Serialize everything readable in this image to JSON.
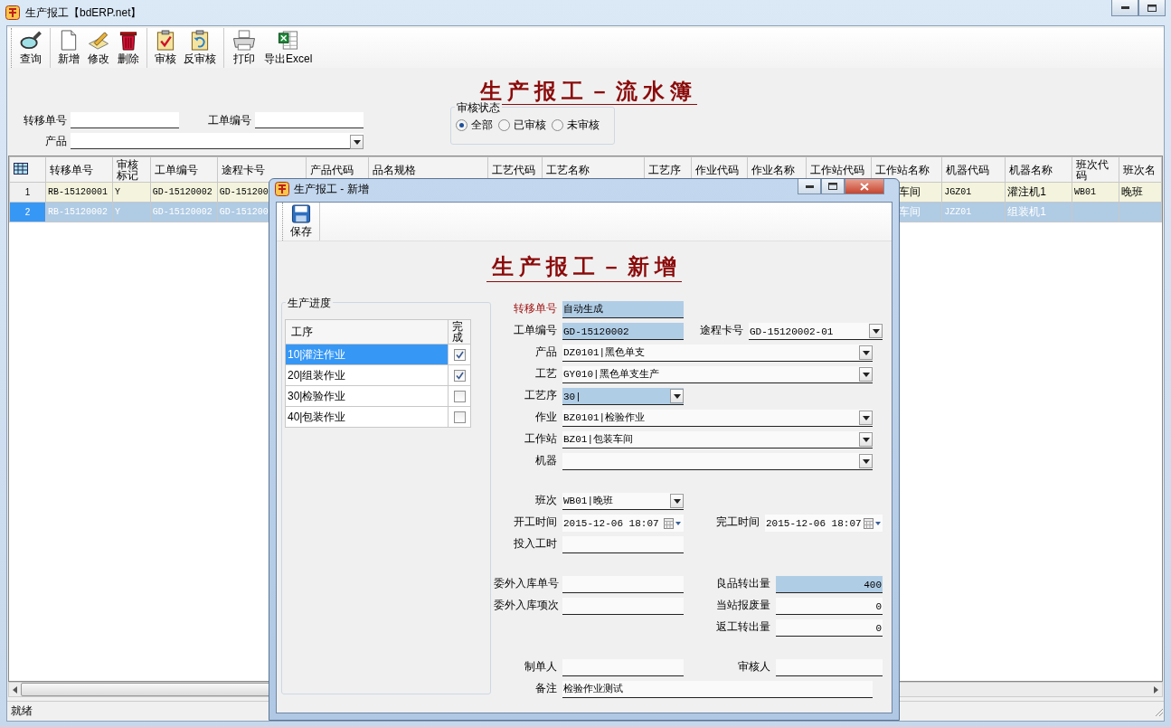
{
  "window": {
    "title": "生产报工【bdERP.net】"
  },
  "toolbar": [
    [
      "查询"
    ],
    [
      "新增",
      "修改",
      "删除"
    ],
    [
      "审核",
      "反审核"
    ],
    [
      "打印",
      "导出Excel"
    ]
  ],
  "page_title": "生产报工－流水簿",
  "filters": {
    "fields": [
      {
        "label": "转移单号",
        "kind": "text"
      },
      {
        "label": "工单编号",
        "kind": "text"
      },
      {
        "label": "产品",
        "kind": "combo"
      }
    ],
    "audit_status": {
      "title": "审核状态",
      "options": [
        {
          "label": "全部",
          "selected": true
        },
        {
          "label": "已审核",
          "selected": false
        },
        {
          "label": "未审核",
          "selected": false
        }
      ]
    }
  },
  "grid": {
    "columns": [
      "转移单号",
      "审核标记",
      "工单编号",
      "途程卡号",
      "产品代码",
      "品名规格",
      "工艺代码",
      "工艺名称",
      "工艺序",
      "作业代码",
      "作业名称",
      "工作站代码",
      "工作站名称",
      "机器代码",
      "机器名称",
      "班次代码",
      "班次名"
    ],
    "rows": [
      {
        "number": "1",
        "selected": false,
        "cells": [
          "RB-15120001",
          "Y",
          "GD-15120002",
          "GD-151200",
          null,
          null,
          null,
          null,
          null,
          null,
          null,
          null,
          "车间",
          "JGZ01",
          "灌注机1",
          "WB01",
          "晚班"
        ]
      },
      {
        "number": "2",
        "selected": true,
        "cells": [
          "RB-15120002",
          "Y",
          "GD-15120002",
          "GD-151200",
          null,
          null,
          null,
          null,
          null,
          null,
          null,
          null,
          "车间",
          "JZZ01",
          "组装机1",
          null,
          null
        ]
      }
    ]
  },
  "status_bar": "就绪",
  "dialog": {
    "title": "生产报工 - 新增",
    "toolbar": [
      "保存"
    ],
    "form_title": "生产报工－新增",
    "progress": {
      "title": "生产进度",
      "columns": [
        "工序",
        "完成"
      ],
      "rows": [
        {
          "label": "10|灌注作业",
          "done": true,
          "selected": true
        },
        {
          "label": "20|组装作业",
          "done": true,
          "selected": false
        },
        {
          "label": "30|检验作业",
          "done": false,
          "selected": false
        },
        {
          "label": "40|包装作业",
          "done": false,
          "selected": false
        }
      ]
    },
    "sections": [
      [
        [
          {
            "label": "转移单号",
            "value": "自动生成",
            "kind": "text",
            "required": true,
            "highlighted": true
          }
        ],
        [
          {
            "label": "工单编号",
            "value": "GD-15120002",
            "kind": "text",
            "required": false,
            "highlighted": true
          },
          {
            "label": "途程卡号",
            "value": "GD-15120002-01",
            "kind": "combo",
            "required": false,
            "highlighted": false
          }
        ],
        [
          {
            "label": "产品",
            "value": "DZ0101|黑色单支",
            "kind": "combo",
            "wide": true,
            "required": false,
            "highlighted": false
          }
        ],
        [
          {
            "label": "工艺",
            "value": "GY010|黑色单支生产",
            "kind": "combo",
            "wide": true,
            "required": false,
            "highlighted": false
          }
        ],
        [
          {
            "label": "工艺序",
            "value": "30|",
            "kind": "combo",
            "required": false,
            "highlighted": true
          }
        ],
        [
          {
            "label": "作业",
            "value": "BZ0101|检验作业",
            "kind": "combo",
            "wide": true,
            "required": false,
            "highlighted": false
          }
        ],
        [
          {
            "label": "工作站",
            "value": "BZ01|包装车间",
            "kind": "combo",
            "wide": true,
            "required": false,
            "highlighted": false
          }
        ],
        [
          {
            "label": "机器",
            "kind": "combo",
            "wide": true,
            "required": false,
            "highlighted": false
          }
        ]
      ],
      [
        [
          {
            "label": "班次",
            "value": "WB01|晚班",
            "kind": "combo",
            "required": false,
            "highlighted": false
          }
        ],
        [
          {
            "label": "开工时间",
            "value": "2015-12-06 18:07",
            "kind": "date",
            "required": false,
            "highlighted": false
          },
          {
            "label": "完工时间",
            "value": "2015-12-06 18:07",
            "kind": "date",
            "required": false,
            "highlighted": false
          }
        ],
        [
          {
            "label": "投入工时",
            "kind": "text",
            "required": false,
            "highlighted": false
          }
        ]
      ],
      [
        [
          {
            "label": "委外入库单号",
            "kind": "text",
            "required": false,
            "highlighted": false
          },
          {
            "label": "良品转出量",
            "value": "400",
            "kind": "number",
            "required": false,
            "highlighted": true
          }
        ],
        [
          {
            "label": "委外入库项次",
            "kind": "text",
            "required": false,
            "highlighted": false
          },
          {
            "label": "当站报废量",
            "value": "0",
            "kind": "number",
            "required": false,
            "highlighted": false
          }
        ],
        [
          {
            "label": "返工转出量",
            "value": "0",
            "kind": "number",
            "required": false,
            "highlighted": false
          }
        ]
      ],
      [
        [
          {
            "label": "制单人",
            "kind": "text",
            "required": false,
            "highlighted": false
          },
          {
            "label": "审核人",
            "kind": "text",
            "required": false,
            "highlighted": false
          }
        ],
        [
          {
            "label": "备注",
            "value": "检验作业测试",
            "kind": "text",
            "wide": true,
            "required": false,
            "highlighted": false
          }
        ]
      ]
    ]
  }
}
